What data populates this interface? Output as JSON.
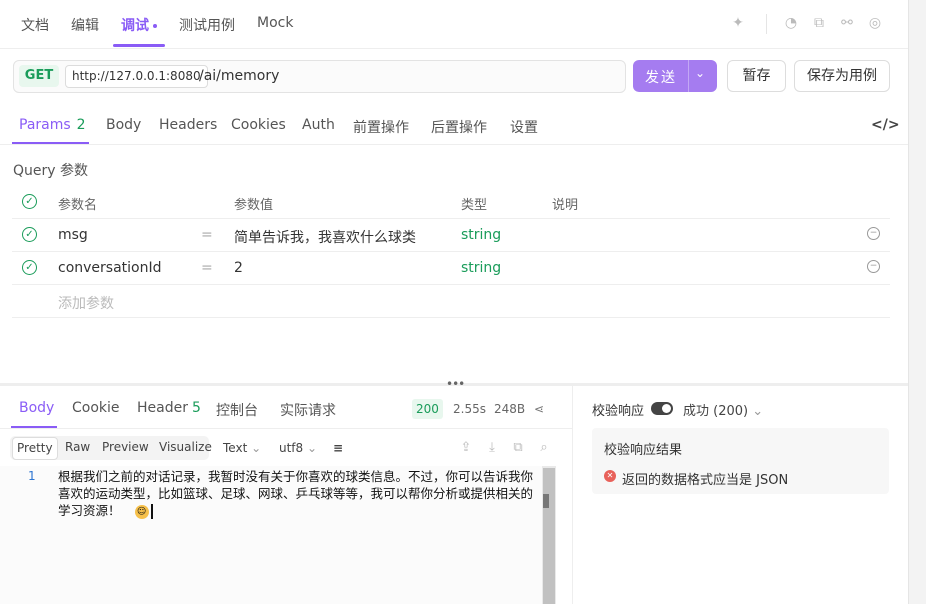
{
  "top_tabs": {
    "tabs": [
      {
        "label": "文档"
      },
      {
        "label": "编辑"
      },
      {
        "label": "调试"
      },
      {
        "label": "测试用例"
      },
      {
        "label": "Mock"
      }
    ]
  },
  "request": {
    "method": "GET",
    "host": "http://127.0.0.1:8080",
    "path": "/ai/memory",
    "send_label": "发送",
    "save_label": "暂存",
    "save_case_label": "保存为用例"
  },
  "params_tabs": {
    "tabs": [
      {
        "label": "Params",
        "count": "2"
      },
      {
        "label": "Body"
      },
      {
        "label": "Headers"
      },
      {
        "label": "Cookies"
      },
      {
        "label": "Auth"
      },
      {
        "label": "前置操作"
      },
      {
        "label": "后置操作"
      },
      {
        "label": "设置"
      }
    ]
  },
  "query": {
    "title": "Query 参数",
    "headers": {
      "name": "参数名",
      "value": "参数值",
      "type": "类型",
      "desc": "说明"
    },
    "rows": [
      {
        "name": "msg",
        "eq": "=",
        "value": "简单告诉我，我喜欢什么球类",
        "type": "string"
      },
      {
        "name": "conversationId",
        "eq": "=",
        "value": "2",
        "type": "string"
      }
    ],
    "add_placeholder": "添加参数"
  },
  "response": {
    "tabs": [
      {
        "label": "Body"
      },
      {
        "label": "Cookie"
      },
      {
        "label": "Header",
        "count": "5"
      },
      {
        "label": "控制台"
      },
      {
        "label": "实际请求"
      }
    ],
    "status": "200",
    "time": "2.55s",
    "size": "248B",
    "formats": [
      "Pretty",
      "Raw",
      "Preview",
      "Visualize"
    ],
    "text_mode": "Text",
    "encoding": "utf8",
    "line_number": "1",
    "body_text": "根据我们之前的对话记录，我暂时没有关于你喜欢的球类信息。不过，你可以告诉我你喜欢的运动类型，比如篮球、足球、网球、乒乓球等等，我可以帮你分析或提供相关的学习资源！"
  },
  "validation": {
    "label": "校验响应",
    "status": "成功 (200)",
    "result_title": "校验响应结果",
    "error": "返回的数据格式应当是 JSON"
  },
  "colors": {
    "accent": "#8a5cf6",
    "success": "#1a9c5a",
    "error": "#e8615a"
  }
}
